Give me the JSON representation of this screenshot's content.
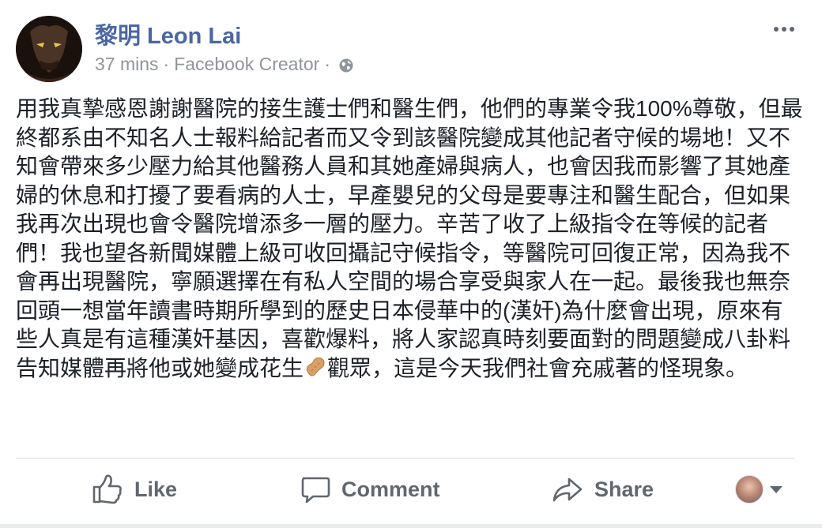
{
  "post": {
    "author": "黎明 Leon Lai",
    "time": "37 mins",
    "separator": "·",
    "app": "Facebook Creator",
    "privacy_icon": "globe-icon",
    "more_icon": "more-options-icon",
    "text_before_emoji": "用我真摯感恩謝謝醫院的接生護士們和醫生們，他們的專業令我100%尊敬，但最終都系由不知名人士報料給記者而又令到該醫院變成其他記者守候的場地！又不知會帶來多少壓力給其他醫務人員和其她產婦與病人，也會因我而影響了其她產婦的休息和打擾了要看病的人士，早產嬰兒的父母是要專注和醫生配合，但如果我再次出現也會令醫院增添多一層的壓力。辛苦了收了上級指令在等候的記者們！我也望各新聞媒體上級可收回攝記守候指令，等醫院可回復正常，因為我不會再出現醫院，寧願選擇在有私人空間的場合享受與家人在一起。最後我也無奈回頭一想當年讀書時期所學到的歷史日本侵華中的(漢奸)為什麼會出現，原來有些人真是有這種漢奸基因，喜歡爆料，將人家認真時刻要面對的問題變成八卦料告知媒體再將他或她變成花生",
    "emoji": "peanut-emoji",
    "text_after_emoji": "觀眾，這是今天我們社會充戚著的怪現象。"
  },
  "actions": {
    "like_label": "Like",
    "comment_label": "Comment",
    "share_label": "Share",
    "like_icon": "thumbs-up-icon",
    "comment_icon": "comment-bubble-icon",
    "share_icon": "share-arrow-icon",
    "reactor_icon": "chevron-down-icon"
  },
  "colors": {
    "author": "#4b67a1",
    "meta": "#90949c",
    "body_text": "#1d2129",
    "action_text": "#606770",
    "divider": "#dadde1"
  }
}
